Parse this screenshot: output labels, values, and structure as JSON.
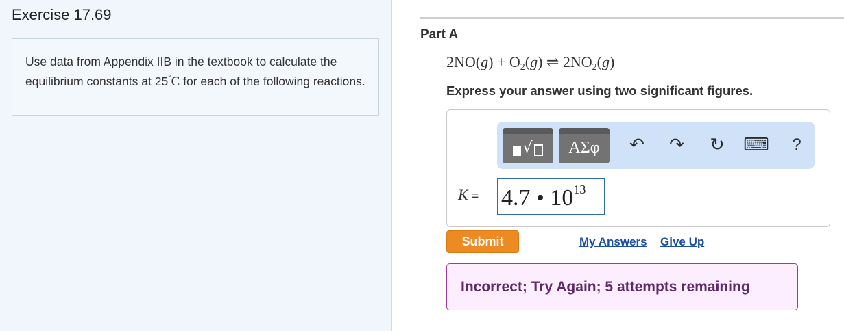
{
  "exercise": {
    "title": "Exercise 17.69",
    "problem_part1": "Use data from Appendix IIB in the textbook to calculate the equilibrium constants at 25",
    "problem_degree": "°",
    "problem_unit": "C",
    "problem_part2": " for each of the following reactions."
  },
  "part": {
    "title": "Part A",
    "equation": {
      "t1": "2NO(",
      "g1": "g",
      "t2": ") + O",
      "sub1": "2",
      "t3": "(",
      "g2": "g",
      "t4": ") ⇌ 2NO",
      "sub2": "2",
      "t5": "(",
      "g3": "g",
      "t6": ")"
    },
    "instructions": "Express your answer using two significant figures."
  },
  "toolbar": {
    "greek_label": "ΑΣφ",
    "undo_icon": "↶",
    "redo_icon": "↷",
    "reset_icon": "↻",
    "keyboard_icon": "⌨",
    "help_label": "?"
  },
  "answer": {
    "variable": "K",
    "equals": " =",
    "mantissa": "4.7 • 10",
    "exponent": "13"
  },
  "actions": {
    "submit": "Submit",
    "my_answers": "My Answers",
    "give_up": "Give Up"
  },
  "feedback": {
    "message": "Incorrect; Try Again; 5 attempts remaining"
  },
  "colors": {
    "submit_bg": "#ed8b22",
    "feedback_bg": "#fceeff",
    "feedback_border": "#9b3c9b",
    "link": "#1c4fa1",
    "toolbar_bg": "#cfe2f7"
  }
}
